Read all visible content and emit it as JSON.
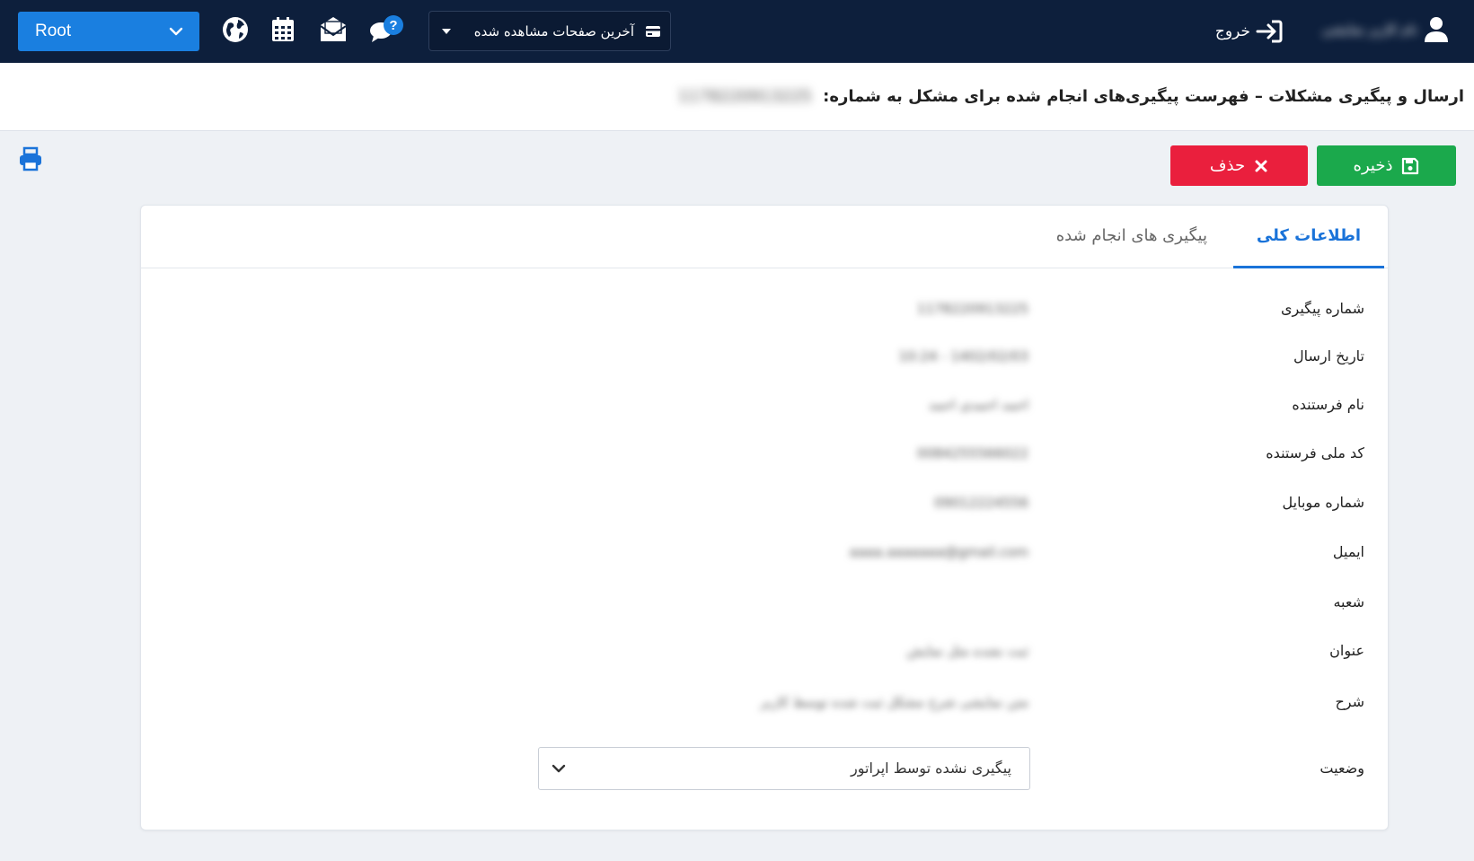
{
  "topbar": {
    "root_label": "Root",
    "recent_pages_label": "آخرین صفحات مشاهده شده",
    "logout_label": "خروج",
    "username": "نام کاربر نمایشی",
    "icons": [
      "globe-icon",
      "calendar-icon",
      "mail-icon",
      "help-chat-icon",
      "user-icon",
      "logout-icon"
    ]
  },
  "title": {
    "text": "ارسال و پیگیری مشکلات – فهرست پیگیری‌های انجام شده برای مشکل به شماره:",
    "issue_number": "1178220913225"
  },
  "toolbar": {
    "save_label": "ذخیره",
    "delete_label": "حذف"
  },
  "tabs": [
    {
      "label": "اطلاعات کلی",
      "active": true
    },
    {
      "label": "پیگیری های انجام شده",
      "active": false
    }
  ],
  "fields": [
    {
      "label": "شماره پیگیری",
      "value": "1178220913225"
    },
    {
      "label": "تاریخ ارسال",
      "value": "1402/02/03 - 10:24"
    },
    {
      "label": "نام فرستنده",
      "value": "احمد احمدی احمد"
    },
    {
      "label": "کد ملی فرستنده",
      "value": "0084255566022"
    },
    {
      "label": "شماره موبایل",
      "value": "09012224556"
    },
    {
      "label": "ایمیل",
      "value": "aaaa.aaaaaaa@gmail.com"
    },
    {
      "label": "شعبه",
      "value": ""
    },
    {
      "label": "عنوان",
      "value": "ثبت نشده مثل نمایش"
    },
    {
      "label": "شرح",
      "value": "متن نمایشی شرح مشکل ثبت شده توسط کاربر"
    }
  ],
  "status": {
    "label": "وضعیت",
    "selected": "پیگیری نشده توسط اپراتور"
  },
  "colors": {
    "navbar": "#0d1f3c",
    "accent": "#1a7fe0",
    "save": "#1ba94c",
    "delete": "#ea1f3d",
    "tab_active": "#1a73d9"
  }
}
